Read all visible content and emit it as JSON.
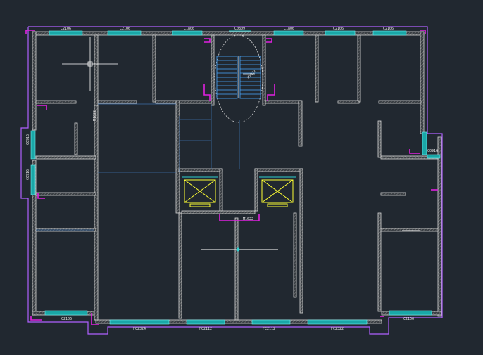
{
  "drawing": {
    "background": "#212830",
    "colors": {
      "wall": "#d8d8d8",
      "window": "#2fd0d0",
      "door": "#e020e0",
      "outline": "#b060ff",
      "elevator": "#ffff33",
      "stair": "#4aa8ff"
    },
    "window_labels_top": [
      "C2106",
      "C2106",
      "C1806",
      "C0809",
      "C1806",
      "C2106",
      "C2106"
    ],
    "window_labels_left": [
      "C0916",
      "C0916"
    ],
    "window_labels_right": [
      "C0916"
    ],
    "window_labels_bottom": [
      "C2106",
      "FC2324",
      "FC2112",
      "FC2112",
      "FC2322",
      "C2106"
    ],
    "labels_misc": [
      "M1022",
      "M1022",
      "M1022"
    ]
  }
}
